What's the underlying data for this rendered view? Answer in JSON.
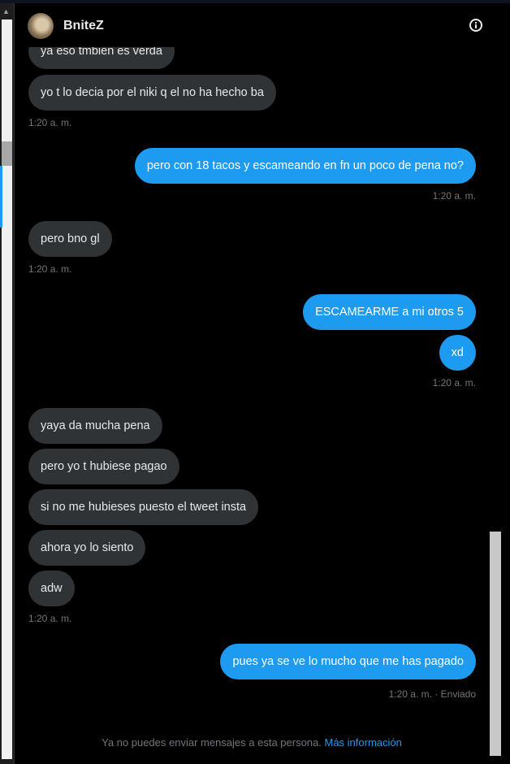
{
  "conversation": {
    "contact_name": "BniteZ",
    "info_icon": "info-circle-icon",
    "avatar_icon": "avatar"
  },
  "messages": [
    {
      "text": "ya eso tmbien es verda",
      "side": "in"
    },
    {
      "text": "yo t lo decia por el niki q el no ha hecho ba",
      "side": "in"
    },
    {
      "text": "pero con 18 tacos y escameando en fn un poco de pena no?",
      "side": "out"
    },
    {
      "text": "pero bno gl",
      "side": "in"
    },
    {
      "text": "ESCAMEARME a mi otros 5",
      "side": "out"
    },
    {
      "text": "xd",
      "side": "out"
    },
    {
      "text": "yaya da mucha pena",
      "side": "in"
    },
    {
      "text": "pero yo t hubiese pagao",
      "side": "in"
    },
    {
      "text": "si no me hubieses puesto el tweet insta",
      "side": "in"
    },
    {
      "text": "ahora yo lo siento",
      "side": "in"
    },
    {
      "text": "adw",
      "side": "in"
    },
    {
      "text": "pues ya se ve lo mucho que me has pagado",
      "side": "out"
    }
  ],
  "timestamps": [
    "1:20 a. m.",
    "1:20 a. m.",
    "1:20 a. m.",
    "1:20 a. m.",
    "1:20 a. m.",
    "1:20 a. m. · Enviado"
  ],
  "footer": {
    "notice": "Ya no puedes enviar mensajes a esta persona.",
    "link": "Más información"
  },
  "colors": {
    "background": "#000000",
    "incoming_bubble": "#2f3336",
    "outgoing_bubble": "#1d9bf0",
    "link": "#1d9bf0",
    "muted_text": "#71767b"
  }
}
